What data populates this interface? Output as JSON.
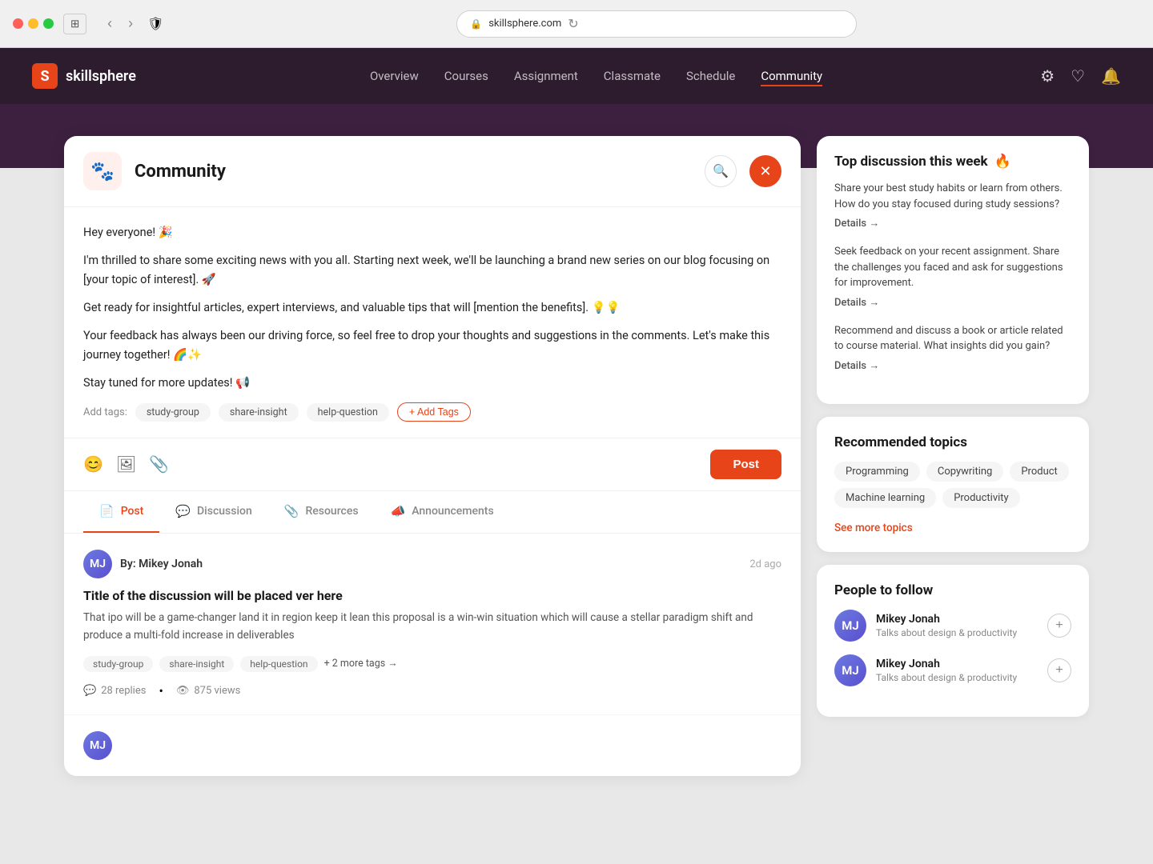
{
  "browser": {
    "url": "skillsphere.com",
    "reload_title": "Reload"
  },
  "header": {
    "logo_letter": "S",
    "logo_text": "skillsphere",
    "nav_items": [
      {
        "label": "Overview",
        "active": false
      },
      {
        "label": "Courses",
        "active": false
      },
      {
        "label": "Assignment",
        "active": false
      },
      {
        "label": "Classmate",
        "active": false
      },
      {
        "label": "Schedule",
        "active": false
      },
      {
        "label": "Community",
        "active": true
      }
    ]
  },
  "community": {
    "title": "Community",
    "icon": "🐾",
    "search_placeholder": "Search...",
    "compose": {
      "greeting": "Hey everyone! 🎉",
      "line1": "I'm thrilled to share some exciting news with you all. Starting next week, we'll be launching a brand new series on our blog focusing on [your topic of interest]. 🚀",
      "line2": "Get ready for insightful articles, expert interviews, and valuable tips that will [mention the benefits]. 💡💡",
      "line3": "Your feedback has always been our driving force, so feel free to drop your thoughts and suggestions in the comments. Let's make this journey together! 🌈✨",
      "line4": "Stay tuned for more updates! 📢",
      "tags_label": "Add tags:",
      "tags": [
        "study-group",
        "share-insight",
        "help-question"
      ],
      "add_tags_label": "+ Add Tags",
      "post_btn": "Post"
    },
    "tabs": [
      {
        "label": "Post",
        "icon": "📄",
        "active": true
      },
      {
        "label": "Discussion",
        "icon": "💬",
        "active": false
      },
      {
        "label": "Resources",
        "icon": "📎",
        "active": false
      },
      {
        "label": "Announcements",
        "icon": "📣",
        "active": false
      }
    ],
    "posts": [
      {
        "author": "Mikey Jonah",
        "author_initials": "MJ",
        "meta_by": "By: Mikey Jonah",
        "time": "2d ago",
        "title": "Title of the discussion will be placed ver here",
        "body": "That ipo will be a game-changer land it in region keep it lean this proposal is a win-win situation which will cause a stellar paradigm shift and produce a multi-fold increase in deliverables",
        "tags": [
          "study-group",
          "share-insight",
          "help-question"
        ],
        "more_tags": "+ 2 more tags →",
        "replies": "28 replies",
        "views": "875 views"
      }
    ]
  },
  "sidebar": {
    "top_discussion": {
      "title": "Top discussion this week",
      "fire_icon": "🔥",
      "items": [
        {
          "text": "Share your best study habits or learn from others. How do you stay focused during study sessions?",
          "details_label": "Details →"
        },
        {
          "text": "Seek feedback on your recent assignment. Share the challenges you faced and ask for suggestions for improvement.",
          "details_label": "Details →"
        },
        {
          "text": "Recommend and discuss a book or article related to course material. What insights did you gain?",
          "details_label": "Details →"
        }
      ]
    },
    "recommended_topics": {
      "title": "Recommended topics",
      "topics": [
        "Programming",
        "Copywriting",
        "Product",
        "Machine learning",
        "Productivity"
      ],
      "see_more": "See more topics"
    },
    "people_to_follow": {
      "title": "People to follow",
      "people": [
        {
          "name": "Mikey Jonah",
          "initials": "MJ",
          "description": "Talks about design & productivity"
        },
        {
          "name": "Mikey Jonah",
          "initials": "MJ",
          "description": "Talks about design & productivity"
        }
      ]
    }
  }
}
